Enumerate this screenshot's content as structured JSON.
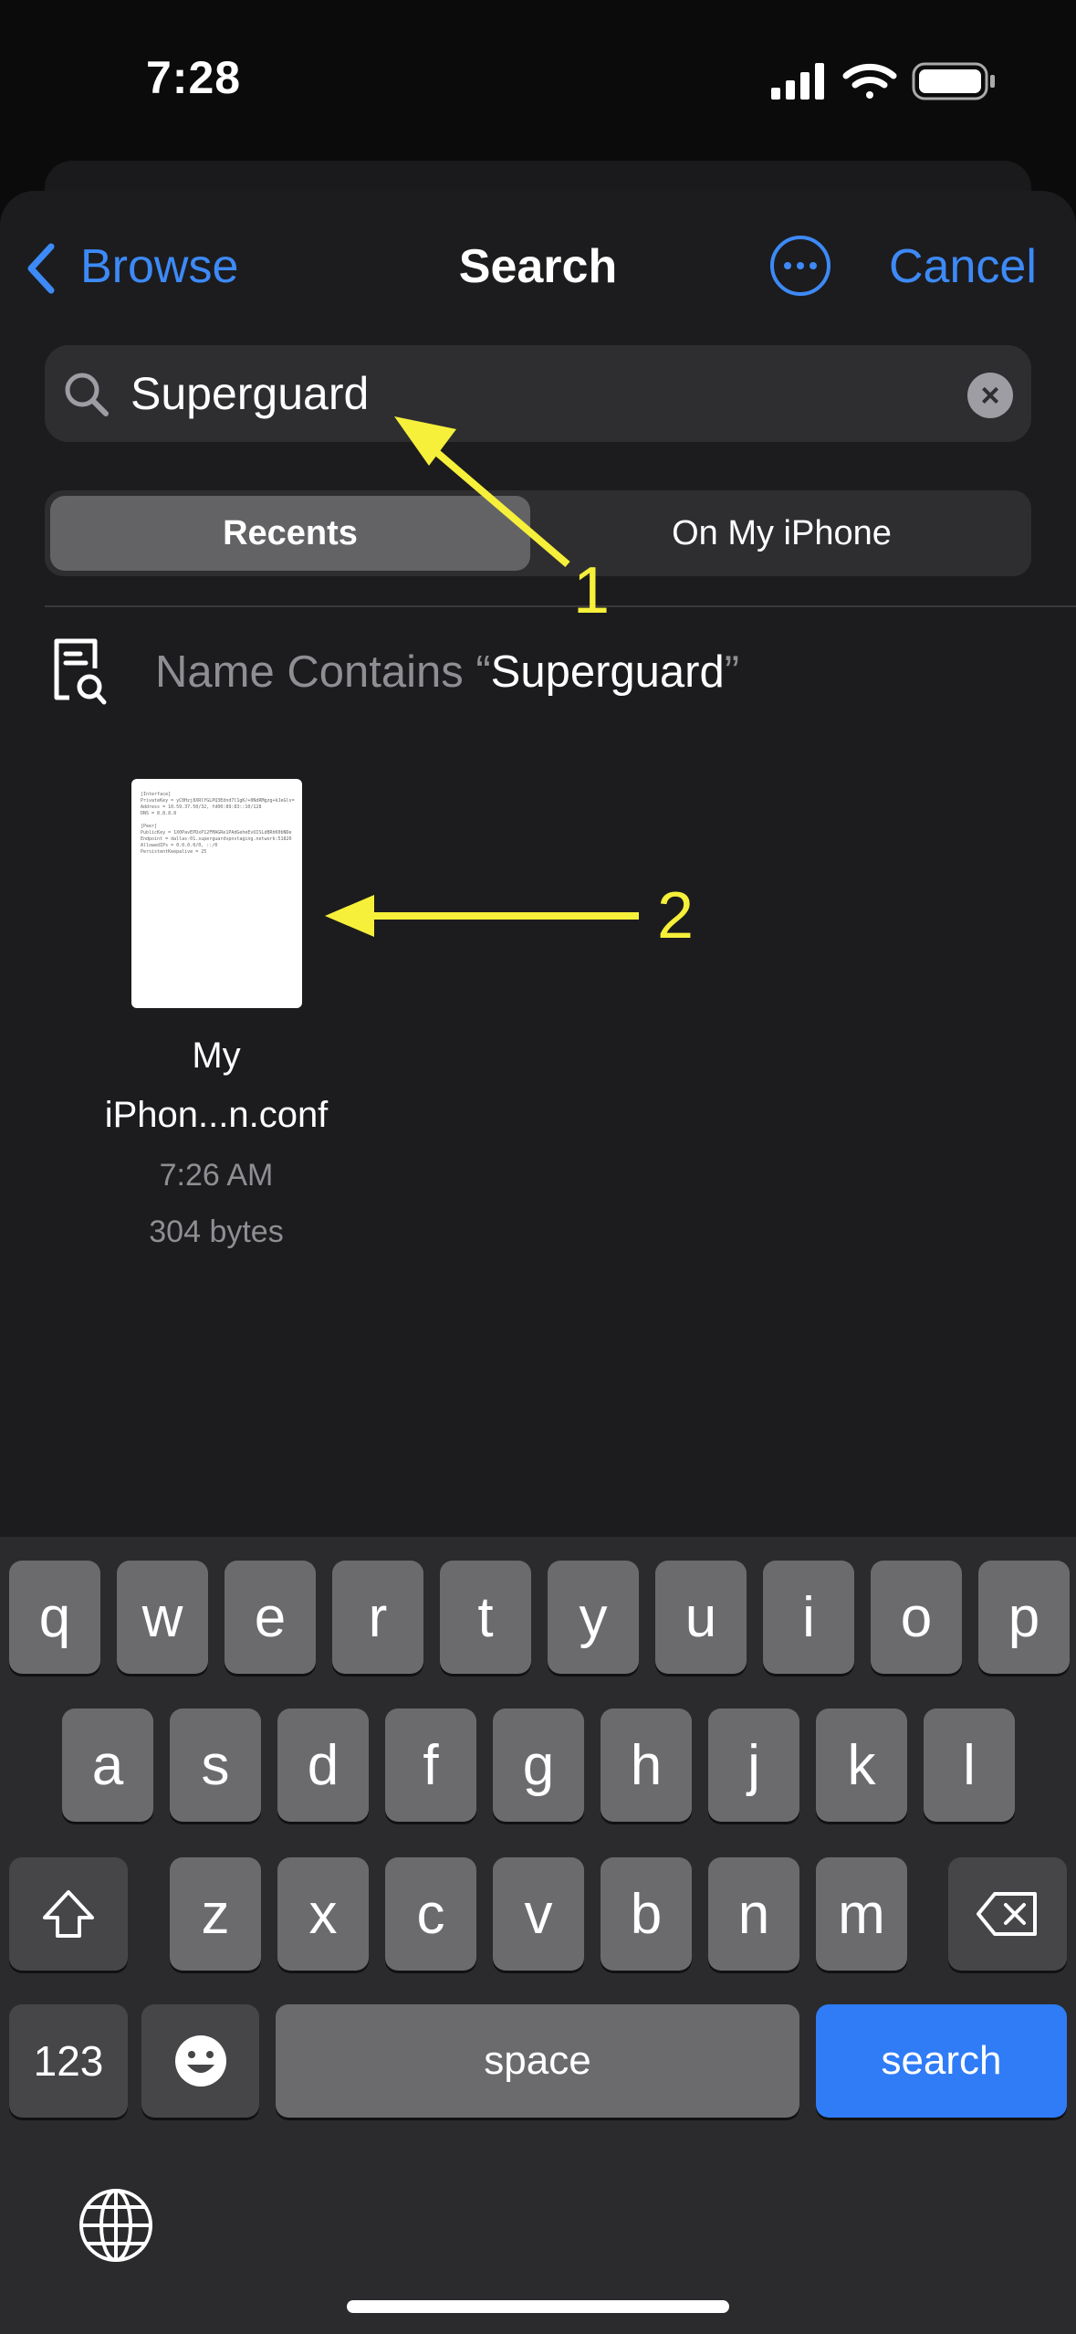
{
  "status_bar": {
    "time": "7:28",
    "icons": [
      "cellular-signal-icon",
      "wifi-icon",
      "battery-icon"
    ]
  },
  "nav": {
    "back_label": "Browse",
    "title": "Search",
    "more_icon": "ellipsis-circle-icon",
    "cancel_label": "Cancel"
  },
  "search": {
    "value": "Superguard",
    "icon": "magnifier-icon",
    "clear_icon": "clear-x-icon"
  },
  "scope": {
    "options": [
      "Recents",
      "On My iPhone"
    ],
    "selected": "Recents"
  },
  "suggestion": {
    "prefix": "Name Contains “",
    "term": "Superguard",
    "suffix": "”"
  },
  "file": {
    "name_line1": "My",
    "name_line2": "iPhon...n.conf",
    "time": "7:26 AM",
    "size": "304 bytes",
    "preview": "[Interface]\nPrivateKey = yC0Hzj8XRlYGLPQ3Ednd7l1gK/+0NdRMgzg+kJeGls=\nAddress = 10.59.37.50/32, fd00:89:83::10/128\nDNS = 8.8.8.8\n\n[Peer]\nPublicKey = 1X0PavEPDxP12FMAGRe1PAdGeheEvUISLdBRhK0bNDe\nEndpoint = dallas-01.superguardvpnstaging.network:51820\nAllowedIPs = 0.0.0.0/0, ::/0\nPersistentKeepalive = 25"
  },
  "annotations": {
    "arrow1": "1",
    "arrow2": "2",
    "color": "#f6f03a"
  },
  "keyboard": {
    "row1": [
      "q",
      "w",
      "e",
      "r",
      "t",
      "y",
      "u",
      "i",
      "o",
      "p"
    ],
    "row2": [
      "a",
      "s",
      "d",
      "f",
      "g",
      "h",
      "j",
      "k",
      "l"
    ],
    "row3": [
      "z",
      "x",
      "c",
      "v",
      "b",
      "n",
      "m"
    ],
    "numbers_label": "123",
    "space_label": "space",
    "search_label": "search",
    "search_color": "#2f7cf6"
  }
}
